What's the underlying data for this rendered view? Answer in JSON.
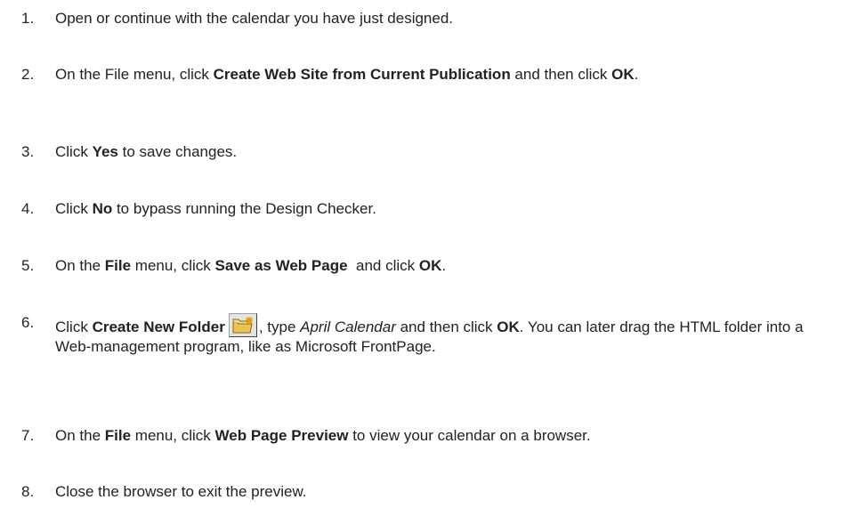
{
  "steps": [
    {
      "num": "1.",
      "parts": [
        {
          "t": "Open or continue with the calendar you have just designed."
        }
      ]
    },
    {
      "num": "2.",
      "parts": [
        {
          "t": "On the File menu, click "
        },
        {
          "t": "Create Web Site from Current Publication",
          "b": true
        },
        {
          "t": " and then click "
        },
        {
          "t": "OK",
          "b": true
        },
        {
          "t": "."
        }
      ]
    },
    {
      "num": "3.",
      "parts": [
        {
          "t": "Click "
        },
        {
          "t": "Yes",
          "b": true
        },
        {
          "t": " to save changes."
        }
      ]
    },
    {
      "num": "4.",
      "parts": [
        {
          "t": "Click "
        },
        {
          "t": "No",
          "b": true
        },
        {
          "t": " to bypass running the Design Checker."
        }
      ]
    },
    {
      "num": "5.",
      "parts": [
        {
          "t": "On the "
        },
        {
          "t": "File",
          "b": true
        },
        {
          "t": " menu, click "
        },
        {
          "t": "Save as Web Page",
          "b": true
        },
        {
          "t": "  and click "
        },
        {
          "t": "OK",
          "b": true
        },
        {
          "t": "."
        }
      ]
    },
    {
      "num": "6.",
      "parts": [
        {
          "t": "Click "
        },
        {
          "t": "Create New Folder",
          "b": true
        },
        {
          "icon": "create-new-folder-icon"
        },
        {
          "t": ", type "
        },
        {
          "t": "April Calendar",
          "i": true
        },
        {
          "t": " and then click "
        },
        {
          "t": "OK",
          "b": true
        },
        {
          "t": ". You can later drag the HTML folder into a Web-management program, like as Microsoft FrontPage."
        }
      ]
    },
    {
      "num": "7.",
      "parts": [
        {
          "t": "On the "
        },
        {
          "t": "File",
          "b": true
        },
        {
          "t": " menu, click "
        },
        {
          "t": "Web Page Preview",
          "b": true
        },
        {
          "t": " to view your calendar on a browser."
        }
      ]
    },
    {
      "num": "8.",
      "parts": [
        {
          "t": "Close the browser to exit the preview."
        }
      ]
    }
  ]
}
